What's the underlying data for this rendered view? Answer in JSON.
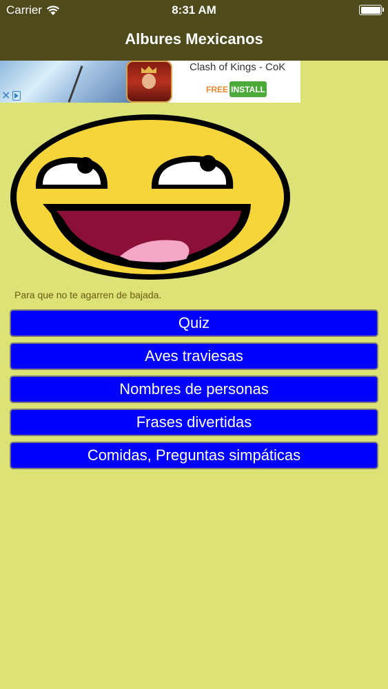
{
  "status_bar": {
    "carrier": "Carrier",
    "time": "8:31 AM"
  },
  "nav": {
    "title": "Albures Mexicanos"
  },
  "ad": {
    "app_name": "Clash of Kings - CoK",
    "price": "FREE",
    "install_label": "INSTALL",
    "close_icon": "close-icon",
    "adchoices_icon": "adchoices-icon"
  },
  "main": {
    "image": "awesome-smiley-face",
    "subtitle": "Para que no te agarren de bajada.",
    "menu": [
      {
        "label": "Quiz"
      },
      {
        "label": "Aves traviesas"
      },
      {
        "label": "Nombres de personas"
      },
      {
        "label": "Frases divertidas"
      },
      {
        "label": "Comidas, Preguntas simpáticas"
      }
    ]
  },
  "colors": {
    "background": "#dde276",
    "nav_bar": "#4e4a1b",
    "button": "#0000ff",
    "subtitle_text": "#6a5b12"
  }
}
